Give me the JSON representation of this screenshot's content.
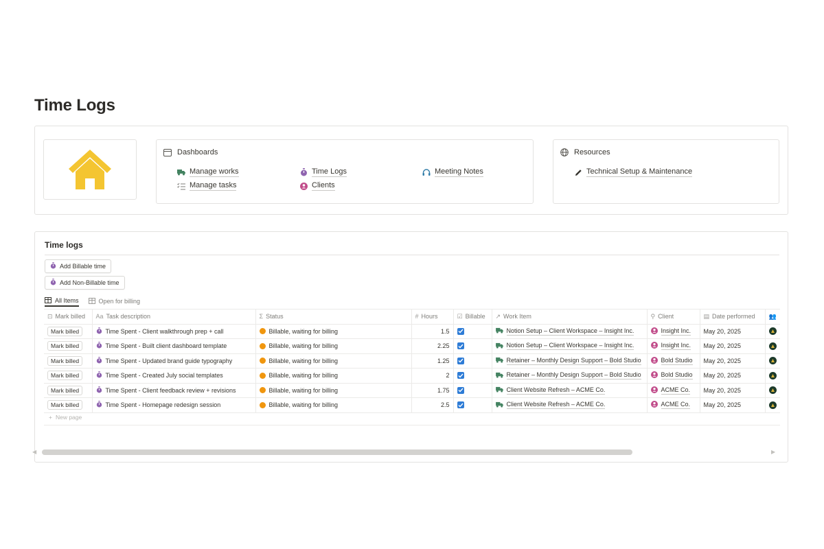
{
  "page": {
    "title": "Time Logs"
  },
  "dashboards": {
    "heading": "Dashboards",
    "links": [
      {
        "label": "Manage works",
        "icon": "truck-icon"
      },
      {
        "label": "Manage tasks",
        "icon": "checklist-icon"
      },
      {
        "label": "Time Logs",
        "icon": "stopwatch-icon"
      },
      {
        "label": "Clients",
        "icon": "person-circle-icon"
      },
      {
        "label": "Meeting Notes",
        "icon": "headset-icon"
      }
    ]
  },
  "resources": {
    "heading": "Resources",
    "links": [
      {
        "label": "Technical Setup & Maintenance",
        "icon": "pencil-icon"
      }
    ]
  },
  "timelogs": {
    "title": "Time logs",
    "buttons": {
      "add_billable": "Add Billable time",
      "add_non_billable": "Add Non-Billable time"
    },
    "views": {
      "all_items": "All Items",
      "open_for_billing": "Open for billing"
    },
    "columns": {
      "mark_billed": "Mark billed",
      "task": "Task description",
      "status": "Status",
      "hours": "Hours",
      "billable": "Billable",
      "work_item": "Work Item",
      "client": "Client",
      "date": "Date performed"
    },
    "rows": [
      {
        "mark": "Mark billed",
        "task": "Time Spent - Client walkthrough prep + call",
        "status": "Billable, waiting for billing",
        "hours": "1.5",
        "billable": true,
        "work_item": "Notion Setup – Client Workspace – Insight Inc.",
        "client": "Insight Inc.",
        "date": "May 20, 2025"
      },
      {
        "mark": "Mark billed",
        "task": "Time Spent - Built client dashboard template",
        "status": "Billable, waiting for billing",
        "hours": "2.25",
        "billable": true,
        "work_item": "Notion Setup – Client Workspace – Insight Inc.",
        "client": "Insight Inc.",
        "date": "May 20, 2025"
      },
      {
        "mark": "Mark billed",
        "task": "Time Spent - Updated brand guide typography",
        "status": "Billable, waiting for billing",
        "hours": "1.25",
        "billable": true,
        "work_item": "Retainer – Monthly Design Support – Bold Studio",
        "client": "Bold Studio",
        "date": "May 20, 2025"
      },
      {
        "mark": "Mark billed",
        "task": "Time Spent - Created July social templates",
        "status": "Billable, waiting for billing",
        "hours": "2",
        "billable": true,
        "work_item": "Retainer – Monthly Design Support – Bold Studio",
        "client": "Bold Studio",
        "date": "May 20, 2025"
      },
      {
        "mark": "Mark billed",
        "task": "Time Spent - Client feedback review + revisions",
        "status": "Billable, waiting for billing",
        "hours": "1.75",
        "billable": true,
        "work_item": "Client Website Refresh – ACME Co.",
        "client": "ACME Co.",
        "date": "May 20, 2025"
      },
      {
        "mark": "Mark billed",
        "task": "Time Spent - Homepage redesign session",
        "status": "Billable, waiting for billing",
        "hours": "2.5",
        "billable": true,
        "work_item": "Client Website Refresh – ACME Co.",
        "client": "ACME Co.",
        "date": "May 20, 2025"
      }
    ],
    "new_page": "New page"
  },
  "colors": {
    "home_icon": "#f4c531",
    "status_dot": "#f0960e",
    "checkbox": "#2e7cd6",
    "truck_icon": "#448361",
    "stopwatch_icon": "#9065b0",
    "person_icon": "#c14c8a",
    "headset_icon": "#337ea9"
  }
}
